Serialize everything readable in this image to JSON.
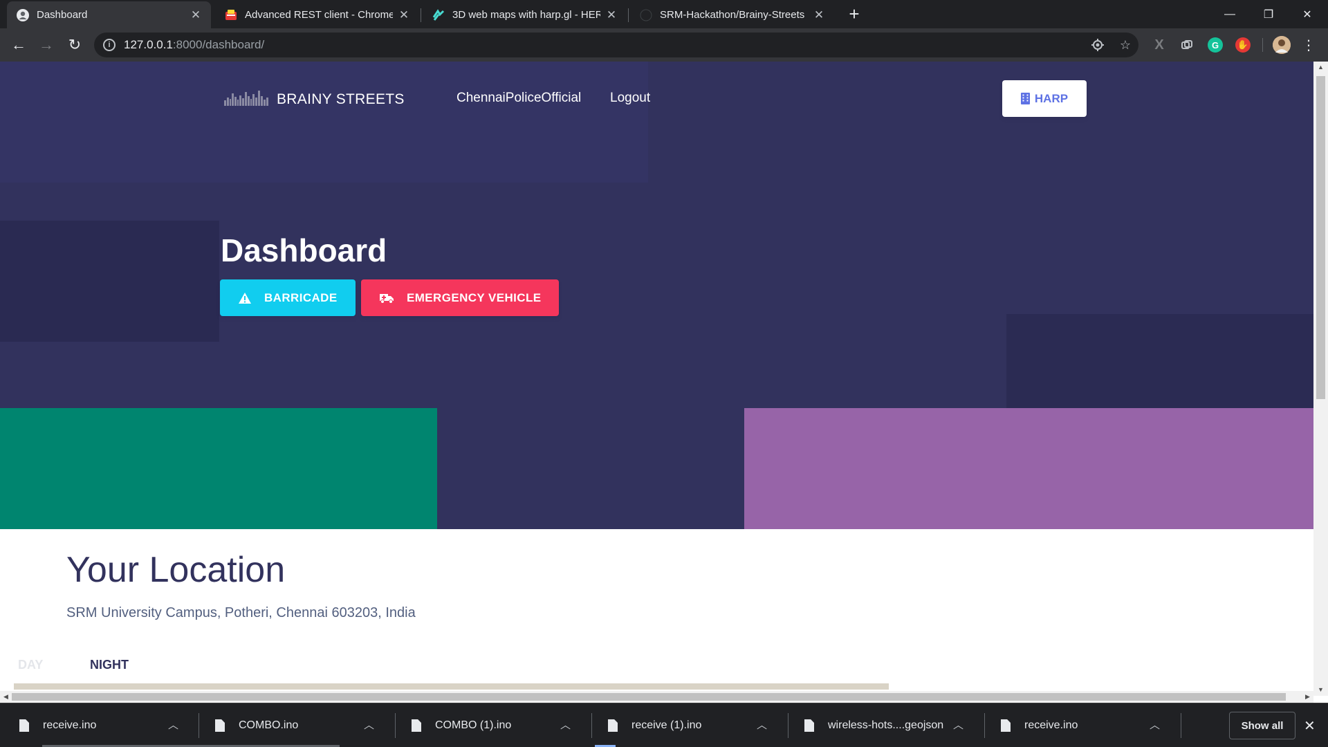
{
  "browser": {
    "tabs": [
      {
        "title": "Dashboard",
        "active": true,
        "icon": "github-avatar-icon"
      },
      {
        "title": "Advanced REST client - Chrome W",
        "active": false,
        "icon": "arc-icon"
      },
      {
        "title": "3D web maps with harp.gl - HERE",
        "active": false,
        "icon": "here-icon"
      },
      {
        "title": "SRM-Hackathon/Brainy-Streets",
        "active": false,
        "icon": "github-icon"
      }
    ],
    "new_tab_label": "+",
    "window_controls": {
      "minimize": "—",
      "restore": "❐",
      "close": "✕"
    },
    "url_host": "127.0.0.1",
    "url_path": ":8000/dashboard/"
  },
  "page": {
    "brand": "BRAINY STREETS",
    "nav": {
      "user": "ChennaiPoliceOfficial",
      "logout": "Logout"
    },
    "harp_button": "HARP",
    "title": "Dashboard",
    "buttons": {
      "barricade": "BARRICADE",
      "emergency": "EMERGENCY VEHICLE"
    },
    "location": {
      "heading": "Your Location",
      "address": "SRM University Campus, Potheri, Chennai 603203, India"
    },
    "tabs": {
      "day": "DAY",
      "night": "NIGHT"
    }
  },
  "colors": {
    "hero": "#32325d",
    "barricade": "#11cdef",
    "emergency": "#f5365c",
    "teal_block": "#00856f",
    "purple_block": "#9764a8"
  },
  "downloads": {
    "items": [
      "receive.ino",
      "COMBO.ino",
      "COMBO (1).ino",
      "receive (1).ino",
      "wireless-hots....geojson",
      "receive.ino"
    ],
    "show_all": "Show all"
  }
}
